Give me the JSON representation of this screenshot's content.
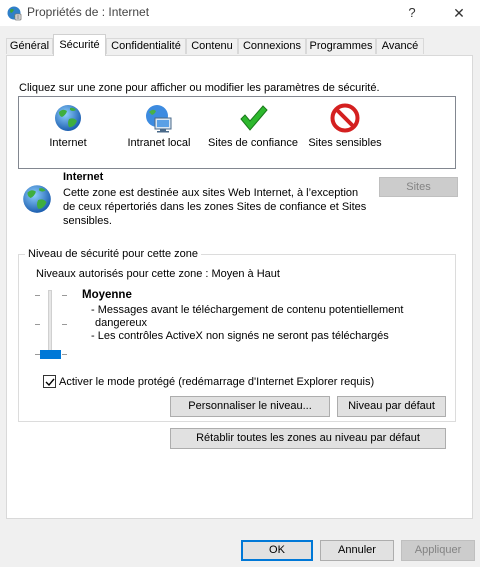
{
  "window": {
    "title": "Propriétés de : Internet",
    "help_label": "?",
    "close_label": "✕"
  },
  "tabs": [
    {
      "label": "Général",
      "active": false
    },
    {
      "label": "Sécurité",
      "active": true
    },
    {
      "label": "Confidentialité",
      "active": false
    },
    {
      "label": "Contenu",
      "active": false
    },
    {
      "label": "Connexions",
      "active": false
    },
    {
      "label": "Programmes",
      "active": false
    },
    {
      "label": "Avancé",
      "active": false
    }
  ],
  "security": {
    "instruction": "Cliquez sur une zone pour afficher ou modifier les paramètres de sécurité.",
    "zones": [
      {
        "label": "Internet",
        "icon": "globe-icon",
        "selected": true
      },
      {
        "label": "Intranet local",
        "icon": "network-computer-icon",
        "selected": false
      },
      {
        "label": "Sites de confiance",
        "icon": "green-check-icon",
        "selected": false
      },
      {
        "label": "Sites sensibles",
        "icon": "red-prohibited-icon",
        "selected": false
      }
    ],
    "selected_zone": {
      "title": "Internet",
      "description_lines": [
        "Cette zone est destinée aux sites Web Internet, à l’exception",
        "de ceux répertoriés dans les zones Sites de confiance et Sites",
        "sensibles."
      ],
      "sites_button": "Sites",
      "sites_enabled": false
    },
    "level": {
      "group_label": "Niveau de sécurité pour cette zone",
      "allowed_levels": "Niveaux autorisés pour cette zone : Moyen à Haut",
      "level_name": "Moyenne",
      "bullets": [
        "- Messages avant le téléchargement de contenu potentiellement",
        "dangereux",
        "- Les contrôles ActiveX non signés ne seront pas téléchargés"
      ],
      "protected_mode_label": "Activer le mode protégé (redémarrage d'Internet Explorer requis)",
      "protected_mode_checked": true,
      "custom_level_button": "Personnaliser le niveau...",
      "default_level_button": "Niveau par défaut"
    },
    "reset_all_button": "Rétablir toutes les zones au niveau par défaut"
  },
  "footer": {
    "ok": "OK",
    "cancel": "Annuler",
    "apply": "Appliquer"
  },
  "colors": {
    "accent": "#0078d7",
    "selected_zone_bg": "#cce8ff",
    "window_bg": "#f0f0f0",
    "panel_bg": "#ffffff"
  }
}
